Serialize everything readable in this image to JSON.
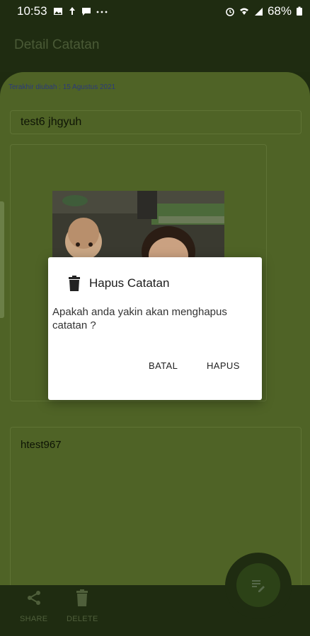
{
  "status_bar": {
    "time": "10:53",
    "battery": "68%"
  },
  "app_bar": {
    "title": "Detail Catatan"
  },
  "note": {
    "last_edited": "Terakhir diubah : 15 Agustus 2021",
    "title": "test6 jhgyuh",
    "body": "htest967"
  },
  "dialog": {
    "title": "Hapus Catatan",
    "message": "Apakah anda yakin akan menghapus catatan ?",
    "cancel_label": "BATAL",
    "confirm_label": "HAPUS"
  },
  "bottom_bar": {
    "share_label": "SHARE",
    "delete_label": "DELETE"
  },
  "icons": {
    "share": "share-icon",
    "delete": "trash-icon",
    "fab": "edit-note-icon"
  },
  "colors": {
    "dark_green": "#1f2c11",
    "sheet_green": "#4f6326",
    "dialog_bg": "#ffffff"
  }
}
